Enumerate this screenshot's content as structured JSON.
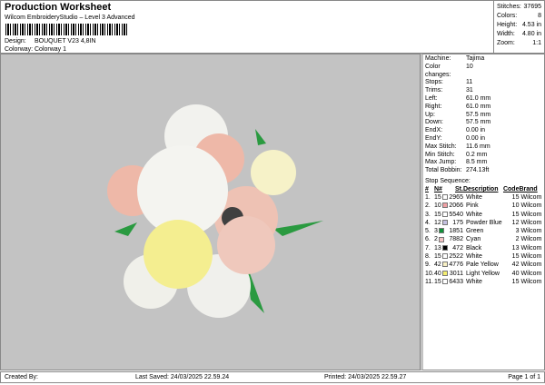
{
  "header": {
    "title": "Production Worksheet",
    "subtitle": "Wilcom EmbroideryStudio – Level 3 Advanced",
    "design_label": "Design:",
    "design": "BOUQUET V23 4,8IN",
    "colorway_label": "Colorway:",
    "colorway": "Colorway 1"
  },
  "stats": [
    {
      "label": "Stitches:",
      "value": "37695"
    },
    {
      "label": "Colors:",
      "value": "8"
    },
    {
      "label": "Height:",
      "value": "4.53 in"
    },
    {
      "label": "Width:",
      "value": "4.80 in"
    },
    {
      "label": "Zoom:",
      "value": "1:1"
    }
  ],
  "info": [
    {
      "label": "Machine:",
      "value": "Tajima"
    },
    {
      "label": "Color changes:",
      "value": "10"
    },
    {
      "label": "Stops:",
      "value": "11"
    },
    {
      "label": "Trims:",
      "value": "31"
    },
    {
      "label": "Left:",
      "value": "61.0 mm"
    },
    {
      "label": "Right:",
      "value": "61.0 mm"
    },
    {
      "label": "Up:",
      "value": "57.5 mm"
    },
    {
      "label": "Down:",
      "value": "57.5 mm"
    },
    {
      "label": "EndX:",
      "value": "0.00 in"
    },
    {
      "label": "EndY:",
      "value": "0.00 in"
    },
    {
      "label": "Max Stitch:",
      "value": "11.6 mm"
    },
    {
      "label": "Min Stitch:",
      "value": "0.2 mm"
    },
    {
      "label": "Max Jump:",
      "value": "8.5 mm"
    },
    {
      "label": "Total Bobbin:",
      "value": "274.13ft"
    }
  ],
  "stop_sequence": {
    "title": "Stop Sequence:",
    "headers": [
      "#",
      "N#",
      "St.",
      "Description",
      "Code",
      "Brand"
    ],
    "rows": [
      {
        "i": "1.",
        "n": "15",
        "color": "#ffffff",
        "st": "2965",
        "desc": "White",
        "code": "15",
        "brand": "Wilcom"
      },
      {
        "i": "2.",
        "n": "10",
        "color": "#f0a0a4",
        "st": "2066",
        "desc": "Pink",
        "code": "10",
        "brand": "Wilcom"
      },
      {
        "i": "3.",
        "n": "15",
        "color": "#ffffff",
        "st": "5540",
        "desc": "White",
        "code": "15",
        "brand": "Wilcom"
      },
      {
        "i": "4.",
        "n": "12",
        "color": "#c4c0e0",
        "st": "175",
        "desc": "Powder Blue",
        "code": "12",
        "brand": "Wilcom"
      },
      {
        "i": "5.",
        "n": "3",
        "color": "#109038",
        "st": "1851",
        "desc": "Green",
        "code": "3",
        "brand": "Wilcom"
      },
      {
        "i": "6.",
        "n": "2",
        "color": "#f4c4c4",
        "st": "7882",
        "desc": "Cyan",
        "code": "2",
        "brand": "Wilcom"
      },
      {
        "i": "7.",
        "n": "13",
        "color": "#000000",
        "st": "472",
        "desc": "Black",
        "code": "13",
        "brand": "Wilcom"
      },
      {
        "i": "8.",
        "n": "15",
        "color": "#ffffff",
        "st": "2522",
        "desc": "White",
        "code": "15",
        "brand": "Wilcom"
      },
      {
        "i": "9.",
        "n": "42",
        "color": "#f8f0c4",
        "st": "4776",
        "desc": "Pale Yellow",
        "code": "42",
        "brand": "Wilcom"
      },
      {
        "i": "10.",
        "n": "40",
        "color": "#f4ee70",
        "st": "3011",
        "desc": "Light Yellow",
        "code": "40",
        "brand": "Wilcom"
      },
      {
        "i": "11.",
        "n": "15",
        "color": "#ffffff",
        "st": "6433",
        "desc": "White",
        "code": "15",
        "brand": "Wilcom"
      }
    ]
  },
  "footer": {
    "created": "Created By:",
    "saved": "Last Saved: 24/03/2025 22.59.24",
    "printed": "Printed: 24/03/2025 22.59.27",
    "page": "Page 1 of 1"
  }
}
